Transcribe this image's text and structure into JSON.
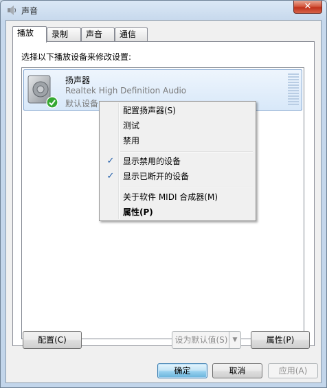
{
  "window": {
    "title": "声音",
    "close_label": "✕"
  },
  "tabs": [
    {
      "label": "播放"
    },
    {
      "label": "录制"
    },
    {
      "label": "声音"
    },
    {
      "label": "通信"
    }
  ],
  "panel": {
    "instruction": "选择以下播放设备来修改设置:"
  },
  "device": {
    "name": "扬声器",
    "description": "Realtek High Definition Audio",
    "status": "默认设备",
    "icon": "speaker-icon",
    "status_icon": "green-check-icon"
  },
  "context_menu": {
    "items": [
      {
        "label": "配置扬声器(S)",
        "checked": false,
        "bold": false
      },
      {
        "label": "测试",
        "checked": false,
        "bold": false
      },
      {
        "label": "禁用",
        "checked": false,
        "bold": false
      },
      {
        "label": "显示禁用的设备",
        "checked": true,
        "bold": false
      },
      {
        "label": "显示已断开的设备",
        "checked": true,
        "bold": false
      },
      {
        "label": "关于软件 MIDI 合成器(M)",
        "checked": false,
        "bold": false
      },
      {
        "label": "属性(P)",
        "checked": false,
        "bold": true
      }
    ],
    "check_glyph": "✓"
  },
  "buttons": {
    "configure": "配置(C)",
    "set_default": "设为默认值(S)",
    "properties": "属性(P)",
    "ok": "确定",
    "cancel": "取消",
    "apply": "应用(A)"
  },
  "colors": {
    "selection_border": "#7da2ce",
    "check": "#1c5aa8",
    "close": "#c0311b"
  }
}
